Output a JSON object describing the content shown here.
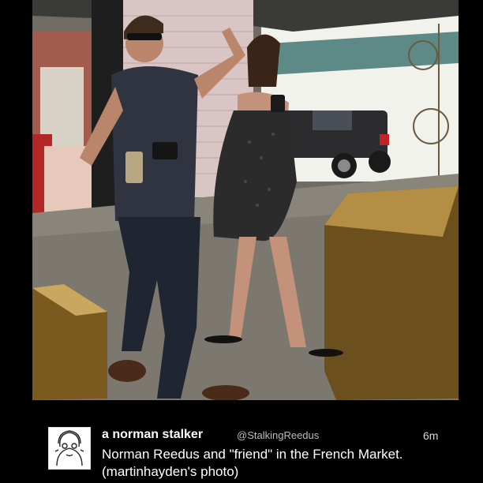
{
  "tweet": {
    "display_name": "a norman stalker",
    "handle": "@StalkingReedus",
    "timestamp": "6m",
    "text": "Norman Reedus and \"friend\" in the French Market. (martinhayden's photo)",
    "avatar_icon": "sketch-portrait-avatar"
  },
  "photo": {
    "description_icon": "photo"
  },
  "colors": {
    "background": "#000000",
    "text_primary": "#ffffff",
    "text_secondary": "#bdbdbd"
  }
}
